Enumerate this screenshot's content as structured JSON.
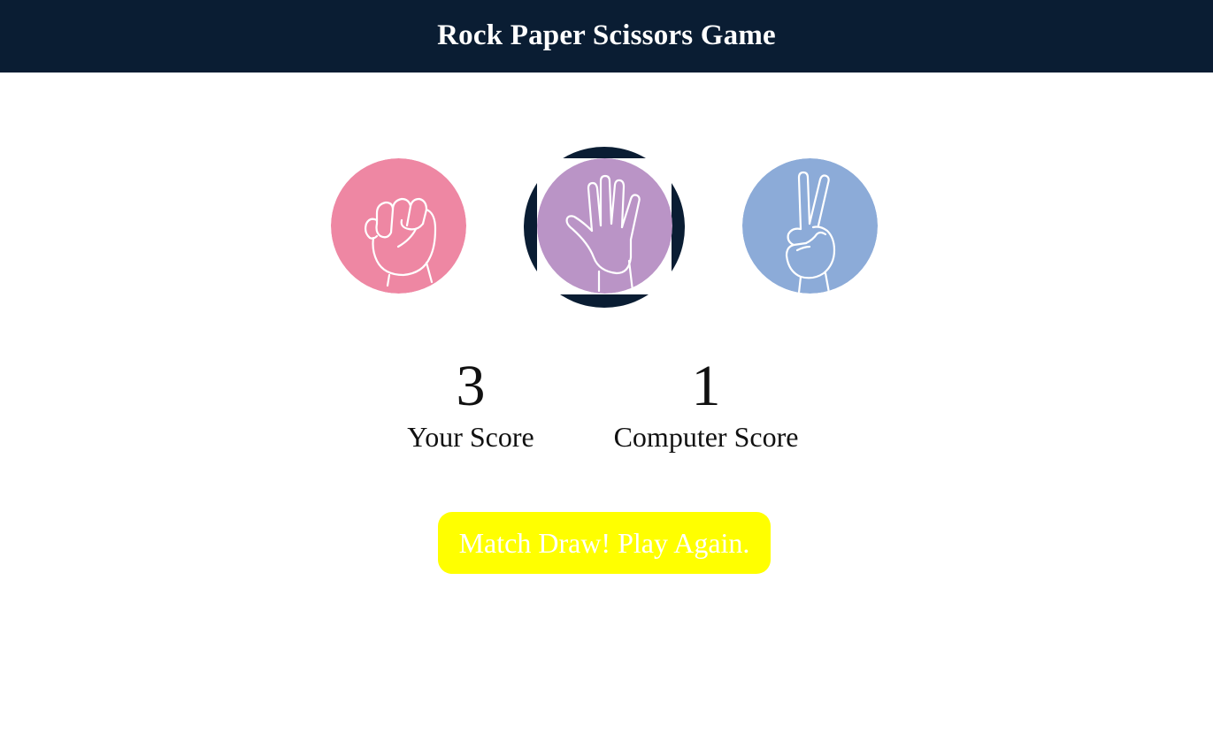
{
  "header": {
    "title": "Rock Paper Scissors Game"
  },
  "colors": {
    "header_bg": "#0a1d33",
    "rock": "#ee87a3",
    "paper": "#ba94c6",
    "scissors": "#8cabd8",
    "selected_ring": "#0a1d33",
    "message_bg": "#ffff00"
  },
  "choices": [
    {
      "id": "rock",
      "icon": "fist-icon",
      "selected": false
    },
    {
      "id": "paper",
      "icon": "open-hand-icon",
      "selected": true
    },
    {
      "id": "scissors",
      "icon": "peace-sign-icon",
      "selected": false
    }
  ],
  "scores": {
    "user": {
      "value": "3",
      "label": "Your Score"
    },
    "computer": {
      "value": "1",
      "label": "Computer Score"
    }
  },
  "message": {
    "text": "Match Draw! Play Again."
  }
}
